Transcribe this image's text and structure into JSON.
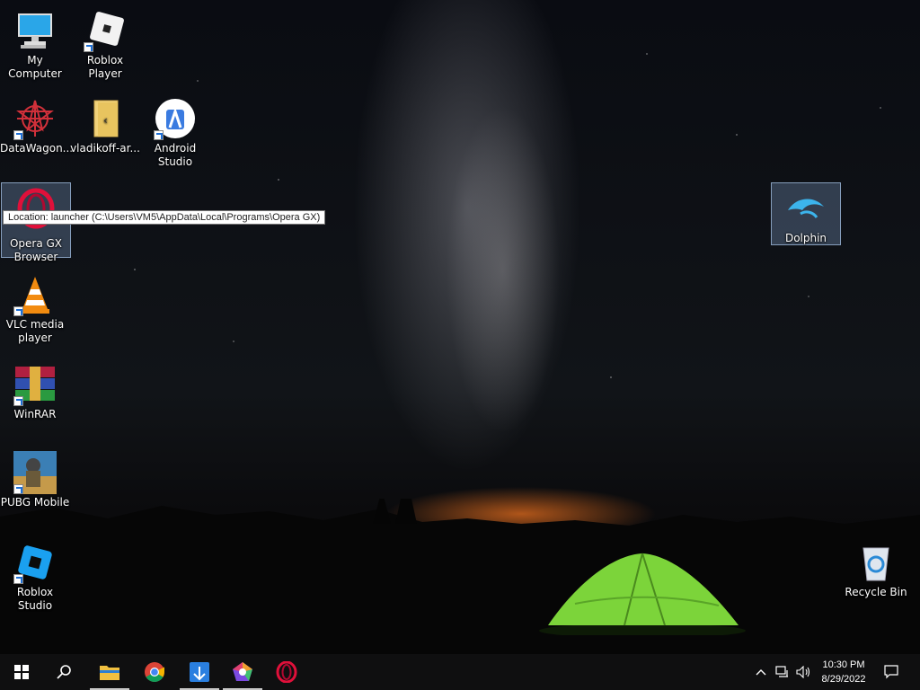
{
  "desktop_icons": [
    {
      "label": "My Computer",
      "icon": "computer-icon"
    },
    {
      "label": "Roblox Player",
      "icon": "roblox-player-icon"
    },
    {
      "label": "DataWagon...",
      "icon": "datawagon-icon"
    },
    {
      "label": "vladikoff-ar...",
      "icon": "folder-icon"
    },
    {
      "label": "Android Studio",
      "icon": "android-studio-icon"
    },
    {
      "label": "Opera GX Browser",
      "icon": "opera-gx-icon"
    },
    {
      "label": "Dolphin",
      "icon": "dolphin-icon"
    },
    {
      "label": "VLC media player",
      "icon": "vlc-icon"
    },
    {
      "label": "WinRAR",
      "icon": "winrar-icon"
    },
    {
      "label": "PUBG Mobile",
      "icon": "pubg-icon"
    },
    {
      "label": "Roblox Studio",
      "icon": "roblox-studio-icon"
    },
    {
      "label": "Recycle Bin",
      "icon": "recycle-bin-icon"
    }
  ],
  "tooltip": "Location: launcher (C:\\Users\\VM5\\AppData\\Local\\Programs\\Opera GX)",
  "taskbar": {
    "start": "windows-start-icon",
    "search": "search-icon",
    "pinned": [
      {
        "name": "file-explorer-icon",
        "running": true
      },
      {
        "name": "chrome-icon",
        "running": false
      },
      {
        "name": "app-installer-icon",
        "running": true
      },
      {
        "name": "app-pentagon-icon",
        "running": true
      },
      {
        "name": "opera-icon",
        "running": false
      }
    ],
    "tray_icons": [
      "chevron-up-icon",
      "network-icon",
      "volume-icon"
    ],
    "time": "10:30 PM",
    "date": "8/29/2022",
    "notification": "action-center-icon"
  },
  "colors": {
    "taskbar": "#0f0f10",
    "accent": "#1d6fd6",
    "tent": "#7cd43a",
    "horizon_glow": "#e66e1e"
  }
}
